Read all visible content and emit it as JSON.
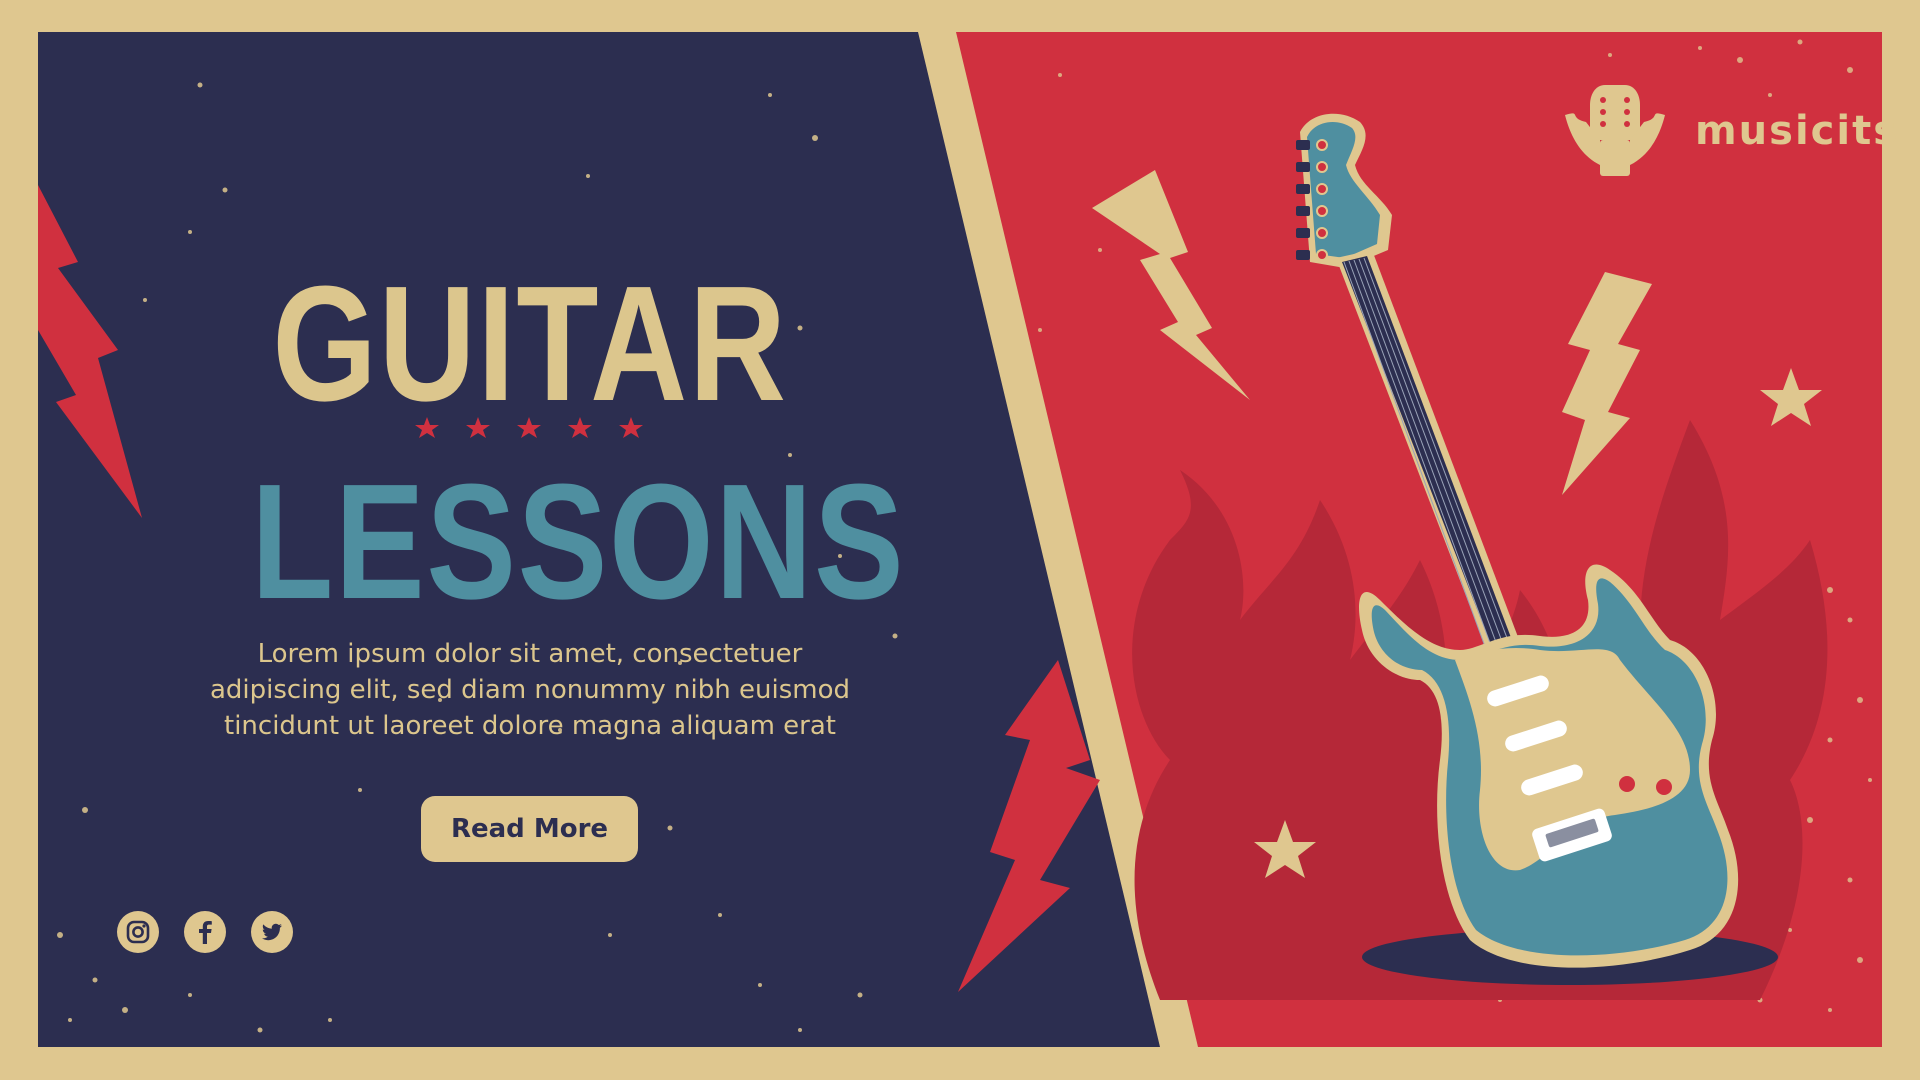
{
  "banner": {
    "title_line1": "GUITAR",
    "title_line2": "LESSONS",
    "description_lines": [
      "Lorem ipsum dolor sit amet, consectetuer",
      "adipiscing elit, sed diam nonummy nibh euismod",
      "tincidunt ut laoreet dolore magna aliquam erat"
    ],
    "read_more_label": "Read More",
    "rating_stars": 5
  },
  "brand": {
    "name": "musicits",
    "logo_icon": "guitar-headstock-wings-icon"
  },
  "social": [
    {
      "name": "instagram",
      "icon": "instagram-icon"
    },
    {
      "name": "facebook",
      "icon": "facebook-icon"
    },
    {
      "name": "twitter",
      "icon": "twitter-icon"
    }
  ],
  "colors": {
    "cream": "#dfc78f",
    "navy": "#2c2e50",
    "red": "#d0303f",
    "teal": "#4f8fa0",
    "dark_red": "#b52838"
  }
}
